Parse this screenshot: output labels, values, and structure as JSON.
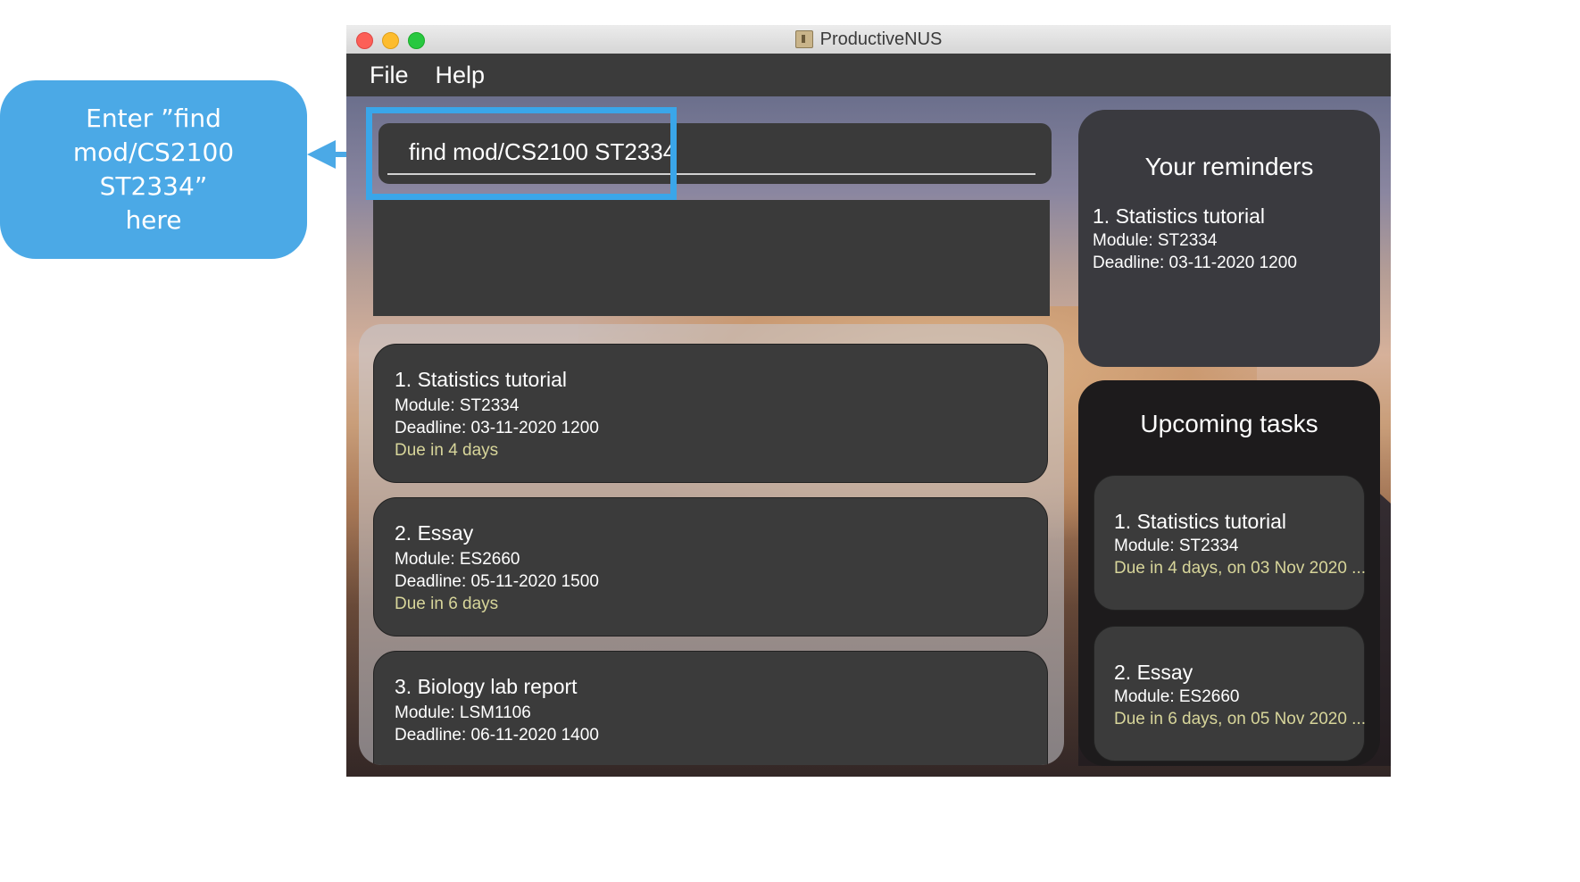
{
  "callout": {
    "text": "Enter ”find\nmod/CS2100 ST2334”\nhere"
  },
  "window": {
    "title": "ProductiveNUS"
  },
  "menu": {
    "file": "File",
    "help": "Help"
  },
  "command": {
    "value": "find mod/CS2100 ST2334"
  },
  "tasks": [
    {
      "title": "1.  Statistics tutorial",
      "module": "Module: ST2334",
      "deadline": "Deadline: 03-11-2020 1200",
      "due": "Due in 4 days"
    },
    {
      "title": "2.  Essay",
      "module": "Module: ES2660",
      "deadline": "Deadline: 05-11-2020 1500",
      "due": "Due in 6 days"
    },
    {
      "title": "3.  Biology lab report",
      "module": "Module: LSM1106",
      "deadline": "Deadline: 06-11-2020 1400",
      "due": ""
    }
  ],
  "reminders": {
    "heading": "Your reminders",
    "item": {
      "title": "1.  Statistics tutorial",
      "module": "Module: ST2334",
      "deadline": "Deadline: 03-11-2020 1200"
    }
  },
  "upcoming": {
    "heading": "Upcoming tasks",
    "items": [
      {
        "title": "1.  Statistics tutorial",
        "module": "Module: ST2334",
        "due": "Due in 4 days, on 03 Nov 2020 ..."
      },
      {
        "title": "2.  Essay",
        "module": "Module: ES2660",
        "due": "Due in 6 days, on 05 Nov 2020 ..."
      }
    ]
  },
  "colors": {
    "callout": "#4ba9e6",
    "highlight": "#3aa6e9",
    "due_text": "#d7d59a",
    "card": "#3b3b3b"
  }
}
